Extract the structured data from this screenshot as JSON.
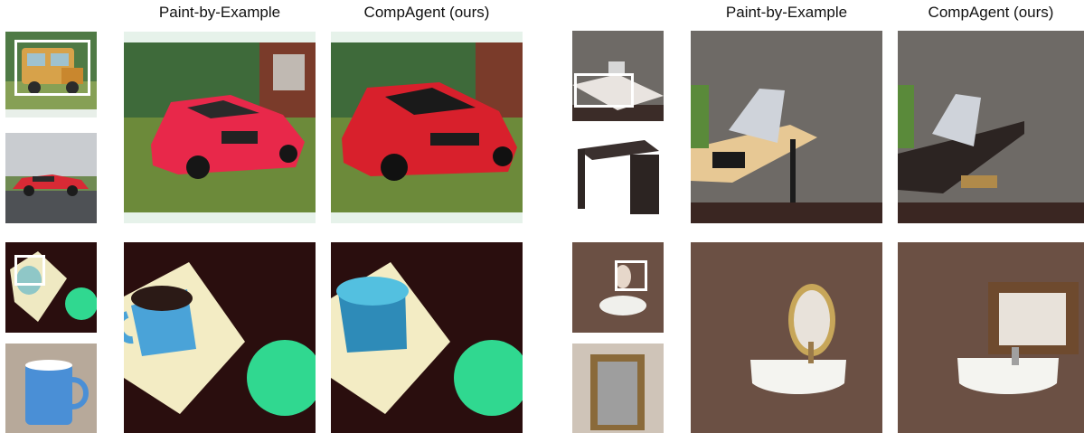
{
  "headers": {
    "left_pbe": "Paint-by-Example",
    "left_ours": "CompAgent (ours)",
    "right_pbe": "Paint-by-Example",
    "right_ours": "CompAgent (ours)"
  },
  "colors": {
    "car_red": "#e8284a",
    "grass": "#6c8a3a",
    "wood_dark": "#2a0e0e",
    "coaster_green": "#30d890",
    "mug_blue": "#4aa3d8",
    "wall_gray": "#6e6a66",
    "wall_brown": "#6b5044",
    "desk_light": "#e7c894",
    "desk_dark": "#2c2422"
  }
}
